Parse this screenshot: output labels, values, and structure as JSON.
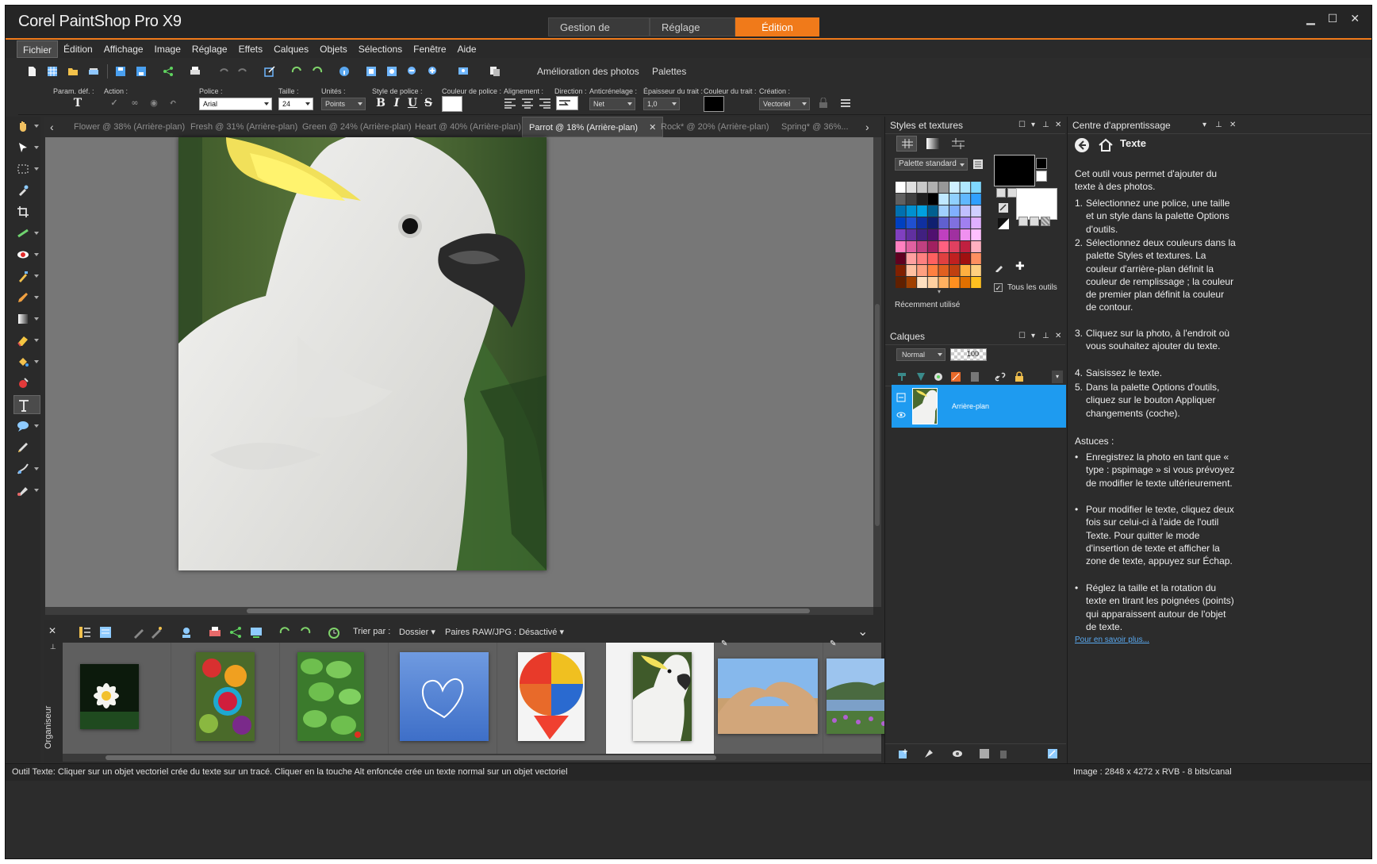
{
  "app": {
    "title": "Corel PaintShop Pro X9",
    "workspace_tabs": [
      "Gestion de photos",
      "Réglage",
      "Édition"
    ],
    "active_workspace": "Édition",
    "accent": "#f07a1a"
  },
  "menu": [
    "Fichier",
    "Édition",
    "Affichage",
    "Image",
    "Réglage",
    "Effets",
    "Calques",
    "Objets",
    "Sélections",
    "Fenêtre",
    "Aide"
  ],
  "toolbar": {
    "enhance_label": "Amélioration des photos",
    "palettes_label": "Palettes"
  },
  "tool_options": {
    "preset_label": "Param. déf. :",
    "action_label": "Action :",
    "font_label": "Police :",
    "font_value": "Arial",
    "size_label": "Taille :",
    "size_value": "24",
    "units_label": "Unités :",
    "units_value": "Points",
    "style_label": "Style de police :",
    "font_color_label": "Couleur de police :",
    "align_label": "Alignement :",
    "direction_label": "Direction :",
    "antialias_label": "Anticrénelage :",
    "antialias_value": "Net",
    "stroke_width_label": "Épaisseur du trait :",
    "stroke_width_value": "1,0",
    "stroke_color_label": "Couleur du trait :",
    "creation_label": "Création :",
    "creation_value": "Vectoriel",
    "style_buttons": [
      "B",
      "I",
      "U",
      "S"
    ]
  },
  "doc_tabs": [
    "Flower @  38% (Arrière-plan)",
    "Fresh @  31% (Arrière-plan)",
    "Green @  24% (Arrière-plan)",
    "Heart @  40% (Arrière-plan)",
    "Parrot @  18% (Arrière-plan)",
    "Rock* @  20% (Arrière-plan)",
    "Spring* @  36%..."
  ],
  "active_doc_tab": "Parrot @  18% (Arrière-plan)",
  "organizer": {
    "title": "Organiseur",
    "sort_label": "Trier par :",
    "sort_value": "Dossier",
    "raw_pairs": "Paires RAW/JPG : Désactivé",
    "thumbnails": [
      "flower",
      "fresh",
      "green",
      "heart",
      "balloon",
      "parrot",
      "rock",
      "spring"
    ],
    "selected_thumbnail": "parrot"
  },
  "styles_panel": {
    "title": "Styles et textures",
    "palette_dropdown": "Palette standard",
    "all_tools": "Tous les outils",
    "recent": "Récemment utilisé"
  },
  "layers_panel": {
    "title": "Calques",
    "blend_mode": "Normal",
    "opacity": "100",
    "layer_name": "Arrière-plan",
    "selected_color": "#1e9bf0"
  },
  "learning_center": {
    "title": "Centre d'apprentissage",
    "topic": "Texte",
    "intro": "Cet outil vous permet d'ajouter du texte à des photos.",
    "steps": [
      "Sélectionnez une police, une taille et un style dans la palette Options d'outils.",
      "Sélectionnez deux couleurs dans la palette Styles et textures. La couleur d'arrière-plan définit la couleur de remplissage ; la couleur de premier plan définit la couleur de contour.",
      "Cliquez sur la photo, à l'endroit où vous souhaitez ajouter du texte.",
      "Saisissez le texte.",
      "Dans la palette Options d'outils, cliquez sur le bouton Appliquer changements (coche)."
    ],
    "tips_title": "Astuces :",
    "tips": [
      "Enregistrez la photo en tant que « type : pspimage » si vous prévoyez de modifier le texte ultérieurement.",
      "Pour modifier le texte, cliquez deux fois sur celui-ci à l'aide de l'outil Texte. Pour quitter le mode d'insertion de texte et afficher la zone de texte, appuyez sur Échap.",
      "Réglez la taille et la rotation du texte en tirant les poignées (points) qui apparaissent autour de l'objet de texte."
    ],
    "link": "Pour en savoir plus..."
  },
  "status": {
    "left": "Outil Texte: Cliquer sur un objet vectoriel crée du texte sur un tracé. Cliquer en la touche Alt enfoncée crée un texte normal sur un objet vectoriel",
    "right": "Image :  2848 x 4272 x RVB - 8 bits/canal"
  }
}
